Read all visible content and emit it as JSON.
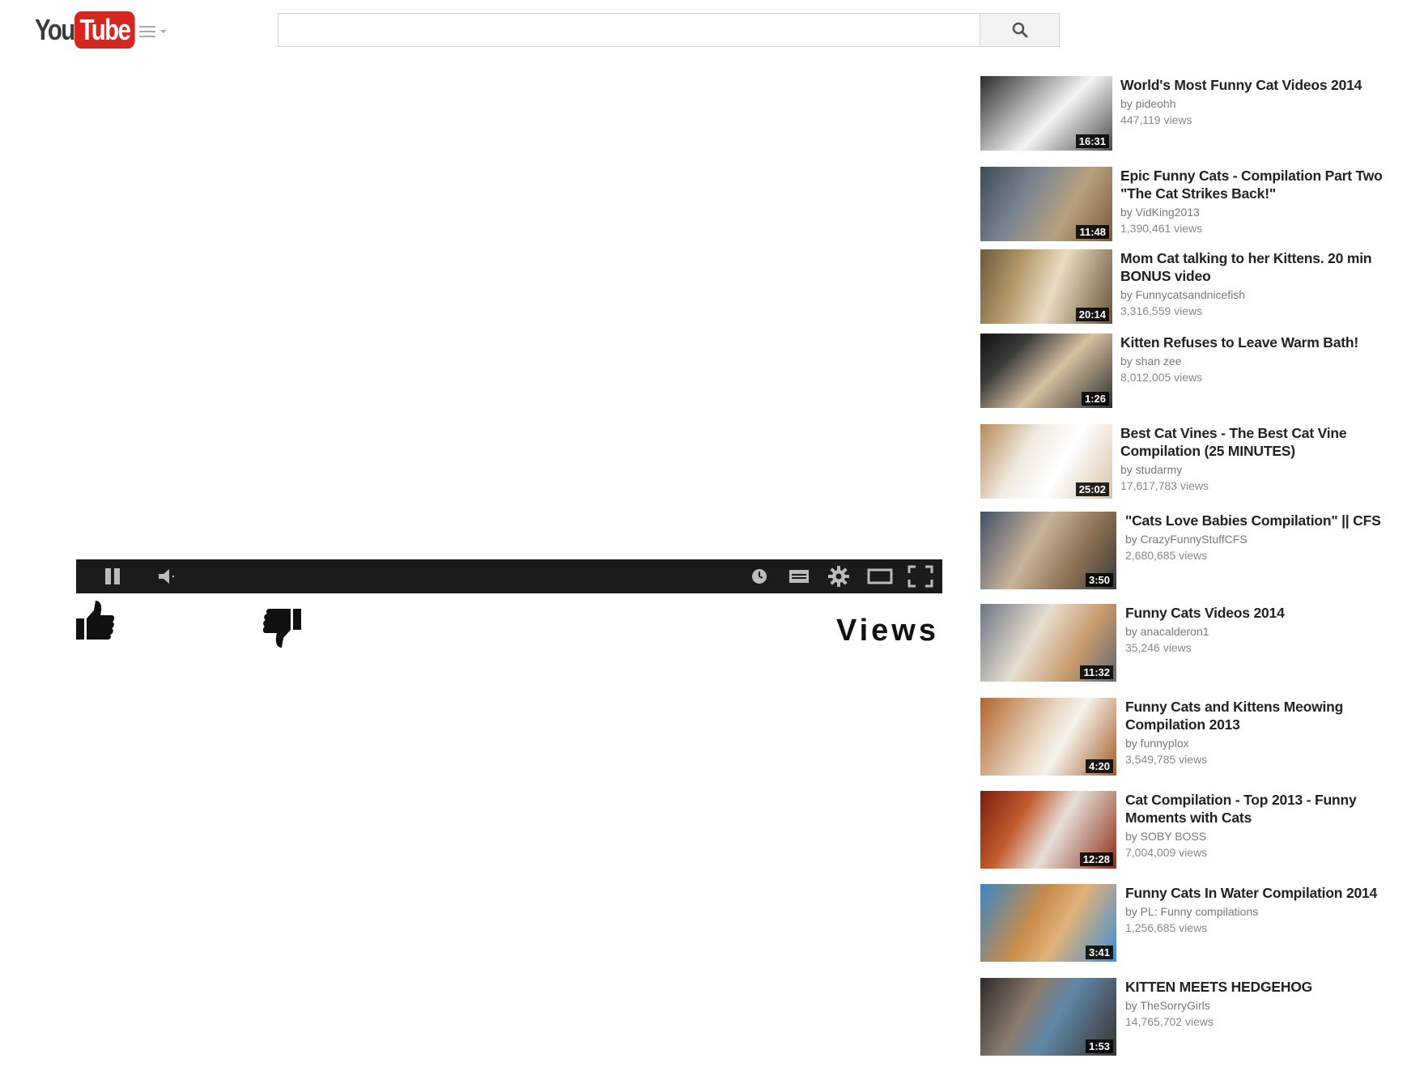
{
  "header": {
    "logo_you": "You",
    "logo_tube": "Tube",
    "search_placeholder": "",
    "search_value": ""
  },
  "player": {
    "views_label": "Views"
  },
  "colors": {
    "brand_red": "#d5261f",
    "player_bar": "#1b1b1b"
  },
  "icons": {
    "menu": "guide-menu-icon",
    "search": "search-icon",
    "pause": "pause-icon",
    "volume": "volume-icon",
    "watch_later": "clock-icon",
    "captions": "captions-icon",
    "settings": "gear-icon",
    "theater": "theater-mode-icon",
    "fullscreen": "fullscreen-icon",
    "like": "thumbs-up-icon",
    "dislike": "thumbs-down-icon"
  },
  "sidebar": {
    "items": [
      {
        "title": "World's Most Funny Cat Videos 2014",
        "by": "by pideohh",
        "views": "447,119 views",
        "duration": "16:31"
      },
      {
        "title": "Epic Funny Cats - Compilation Part Two \"The Cat Strikes Back!\"",
        "by": "by VidKing2013",
        "views": "1,390,461 views",
        "duration": "11:48"
      },
      {
        "title": "Mom Cat talking to her Kittens. 20 min BONUS video",
        "by": "by Funnycatsandnicefish",
        "views": "3,316,559 views",
        "duration": "20:14"
      },
      {
        "title": "Kitten Refuses to Leave Warm Bath!",
        "by": "by shan zee",
        "views": "8,012,005 views",
        "duration": "1:26"
      },
      {
        "title": "Best Cat Vines - The Best Cat Vine Compilation (25 MINUTES)",
        "by": "by studarmy",
        "views": "17,617,783 views",
        "duration": "25:02"
      },
      {
        "title": "\"Cats Love Babies Compilation\" || CFS",
        "by": "by CrazyFunnyStuffCFS",
        "views": "2,680,685 views",
        "duration": "3:50"
      },
      {
        "title": "Funny Cats Videos 2014",
        "by": "by anacalderon1",
        "views": "35,246 views",
        "duration": "11:32"
      },
      {
        "title": "Funny Cats and Kittens Meowing Compilation 2013",
        "by": "by funnyplox",
        "views": "3,549,785 views",
        "duration": "4:20"
      },
      {
        "title": "Cat Compilation - Top 2013 - Funny Moments with Cats",
        "by": "by SOBY BOSS",
        "views": "7,004,009 views",
        "duration": "12:28"
      },
      {
        "title": "Funny Cats In Water Compilation 2014",
        "by": "by PL: Funny compilations",
        "views": "1,256,685 views",
        "duration": "3:41"
      },
      {
        "title": "KITTEN MEETS HEDGEHOG",
        "by": "by TheSorryGirls",
        "views": "14,765,702 views",
        "duration": "1:53"
      }
    ]
  }
}
